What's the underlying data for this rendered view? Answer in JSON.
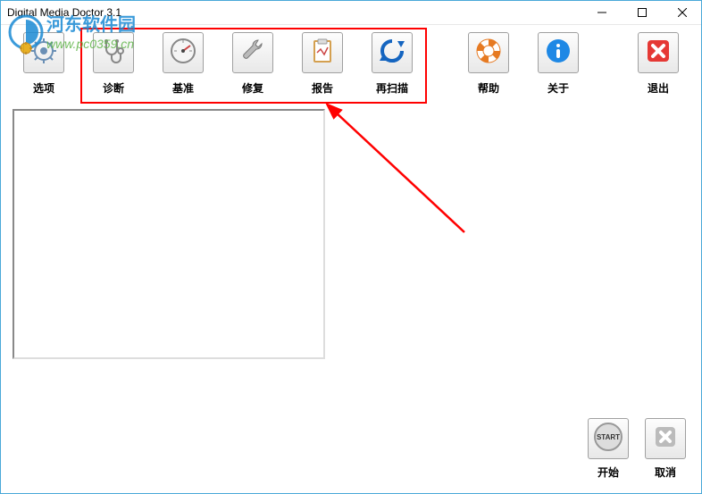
{
  "window": {
    "title": "Digital Media Doctor 3.1"
  },
  "toolbar": {
    "options": "选项",
    "diagnose": "诊断",
    "benchmark": "基准",
    "repair": "修复",
    "report": "报告",
    "rescan": "再扫描",
    "help": "帮助",
    "about": "关于",
    "exit": "退出"
  },
  "bottom": {
    "start": "开始",
    "cancel": "取消",
    "start_icon_text": "START"
  },
  "watermark": {
    "text1": "河东软件园",
    "text2": "www.pc0359.cn"
  }
}
